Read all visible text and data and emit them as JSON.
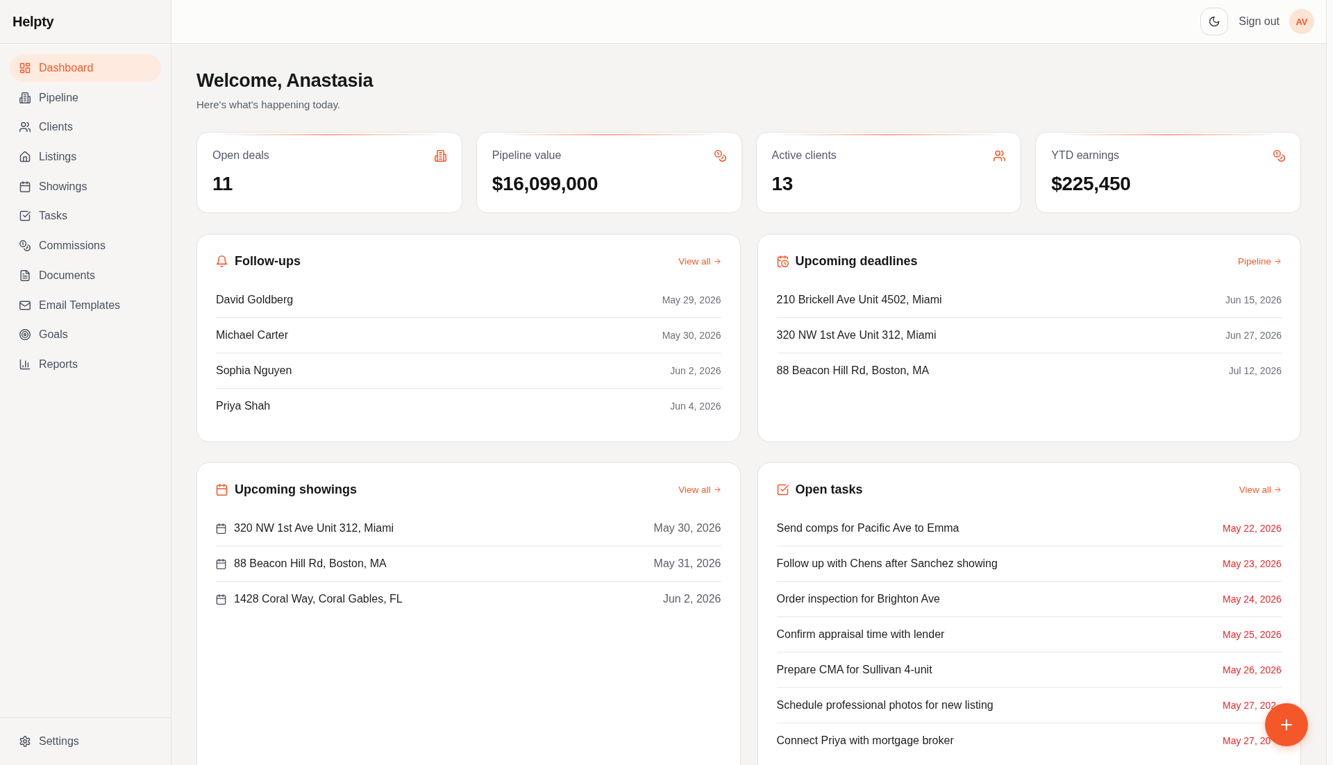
{
  "sidebar": {
    "logo": "Helpty",
    "nav": [
      {
        "label": "Dashboard",
        "selected": true
      },
      {
        "label": "Pipeline",
        "selected": false
      },
      {
        "label": "Clients",
        "selected": false
      },
      {
        "label": "Listings",
        "selected": false
      },
      {
        "label": "Showings",
        "selected": false
      },
      {
        "label": "Tasks",
        "selected": false
      },
      {
        "label": "Commissions",
        "selected": false
      },
      {
        "label": "Documents",
        "selected": false
      },
      {
        "label": "Email Templates",
        "selected": false
      },
      {
        "label": "Goals",
        "selected": false
      },
      {
        "label": "Reports",
        "selected": false
      }
    ],
    "footer": [
      {
        "label": "Settings",
        "selected": false
      }
    ]
  },
  "top_bar": {
    "sign_out": "Sign out",
    "avatar": "AV"
  },
  "welcome": {
    "title": "Welcome, Anastasia",
    "subtitle": "Here's what's happening today."
  },
  "stats": [
    {
      "label": "Open deals",
      "value": "11"
    },
    {
      "label": "Pipeline value",
      "value": "$16,099,000"
    },
    {
      "label": "Active clients",
      "value": "13"
    },
    {
      "label": "YTD earnings",
      "value": "$225,450"
    }
  ],
  "panels": [
    {
      "kind": "followups",
      "title": "Follow-ups",
      "link": "View all",
      "rows": [
        {
          "text": "David Goldberg",
          "date": "May 29, 2026"
        },
        {
          "text": "Michael Carter",
          "date": "May 30, 2026"
        },
        {
          "text": "Sophia Nguyen",
          "date": "Jun 2, 2026"
        },
        {
          "text": "Priya Shah",
          "date": "Jun 4, 2026"
        }
      ]
    },
    {
      "kind": "deadlines",
      "title": "Upcoming deadlines",
      "link": "Pipeline",
      "rows": [
        {
          "text": "210 Brickell Ave Unit 4502, Miami",
          "date": "Jun 15, 2026"
        },
        {
          "text": "320 NW 1st Ave Unit 312, Miami",
          "date": "Jun 27, 2026"
        },
        {
          "text": "88 Beacon Hill Rd, Boston, MA",
          "date": "Jul 12, 2026"
        }
      ]
    },
    {
      "kind": "showings",
      "title": "Upcoming showings",
      "link": "View all",
      "rows": [
        {
          "text": "320 NW 1st Ave Unit 312, Miami",
          "date": "May 30, 2026"
        },
        {
          "text": "88 Beacon Hill Rd, Boston, MA",
          "date": "May 31, 2026"
        },
        {
          "text": "1428 Coral Way, Coral Gables, FL",
          "date": "Jun 2, 2026"
        }
      ]
    },
    {
      "kind": "tasks",
      "title": "Open tasks",
      "link": "View all",
      "rows": [
        {
          "text": "Send comps for Pacific Ave to Emma",
          "date": "May 22, 2026",
          "overdue": true
        },
        {
          "text": "Follow up with Chens after Sanchez showing",
          "date": "May 23, 2026",
          "overdue": true
        },
        {
          "text": "Order inspection for Brighton Ave",
          "date": "May 24, 2026",
          "overdue": true
        },
        {
          "text": "Confirm appraisal time with lender",
          "date": "May 25, 2026",
          "overdue": true
        },
        {
          "text": "Prepare CMA for Sullivan 4-unit",
          "date": "May 26, 2026",
          "overdue": true
        },
        {
          "text": "Schedule professional photos for new listing",
          "date": "May 27, 202",
          "overdue": true
        },
        {
          "text": "Connect Priya with mortgage broker",
          "date": "May 27, 20",
          "overdue": true
        }
      ]
    }
  ]
}
